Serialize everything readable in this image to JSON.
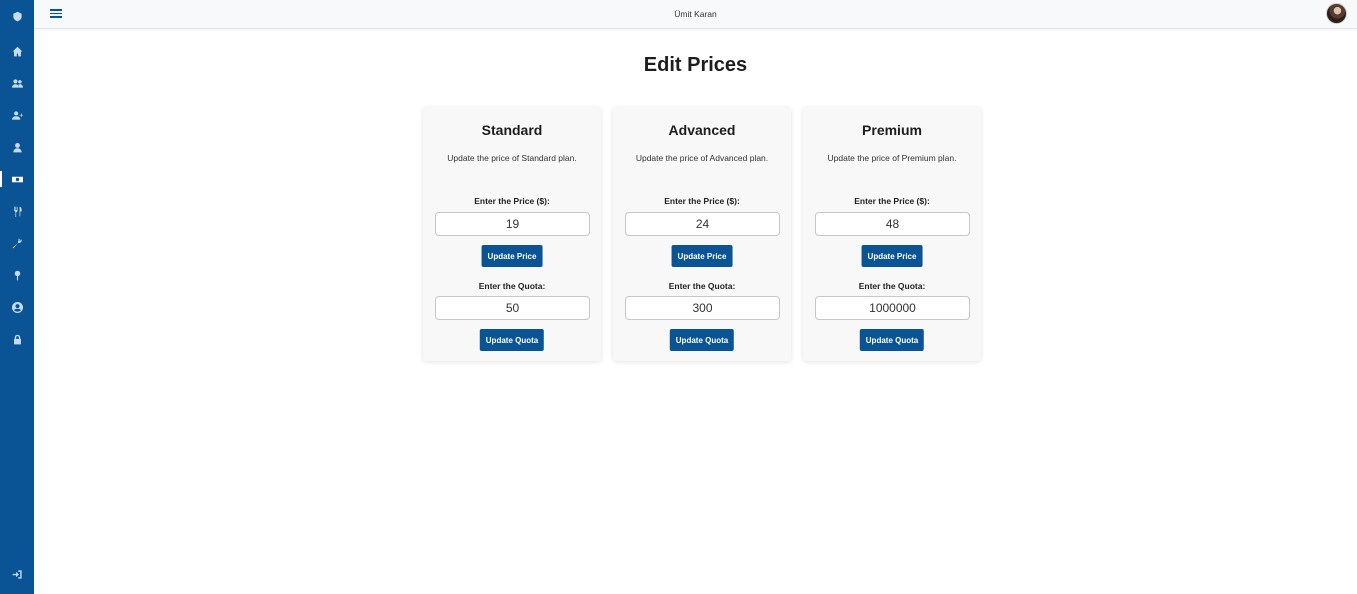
{
  "topbar": {
    "user_name": "Ümit Karan"
  },
  "page": {
    "title": "Edit Prices"
  },
  "sidebar": {
    "items": [
      {
        "icon": "logo-icon"
      },
      {
        "icon": "home-icon"
      },
      {
        "icon": "users-icon"
      },
      {
        "icon": "user-plus-icon"
      },
      {
        "icon": "user-icon"
      },
      {
        "icon": "money-bill-icon",
        "active": true
      },
      {
        "icon": "utensils-icon"
      },
      {
        "icon": "wrench-icon"
      },
      {
        "icon": "map-pin-icon"
      },
      {
        "icon": "user-circle-icon"
      },
      {
        "icon": "lock-icon"
      },
      {
        "icon": "sign-out-icon"
      }
    ]
  },
  "plans": [
    {
      "name": "Standard",
      "description": "Update the price of Standard plan.",
      "price_label": "Enter the Price ($):",
      "price": "19",
      "price_button": "Update Price",
      "quota_label": "Enter the Quota:",
      "quota": "50",
      "quota_button": "Update Quota"
    },
    {
      "name": "Advanced",
      "description": "Update the price of Advanced plan.",
      "price_label": "Enter the Price ($):",
      "price": "24",
      "price_button": "Update Price",
      "quota_label": "Enter the Quota:",
      "quota": "300",
      "quota_button": "Update Quota"
    },
    {
      "name": "Premium",
      "description": "Update the price of Premium plan.",
      "price_label": "Enter the Price ($):",
      "price": "48",
      "price_button": "Update Price",
      "quota_label": "Enter the Quota:",
      "quota": "1000000",
      "quota_button": "Update Quota"
    }
  ],
  "colors": {
    "primary": "#0a5496",
    "card_bg": "#f8f8f8"
  }
}
